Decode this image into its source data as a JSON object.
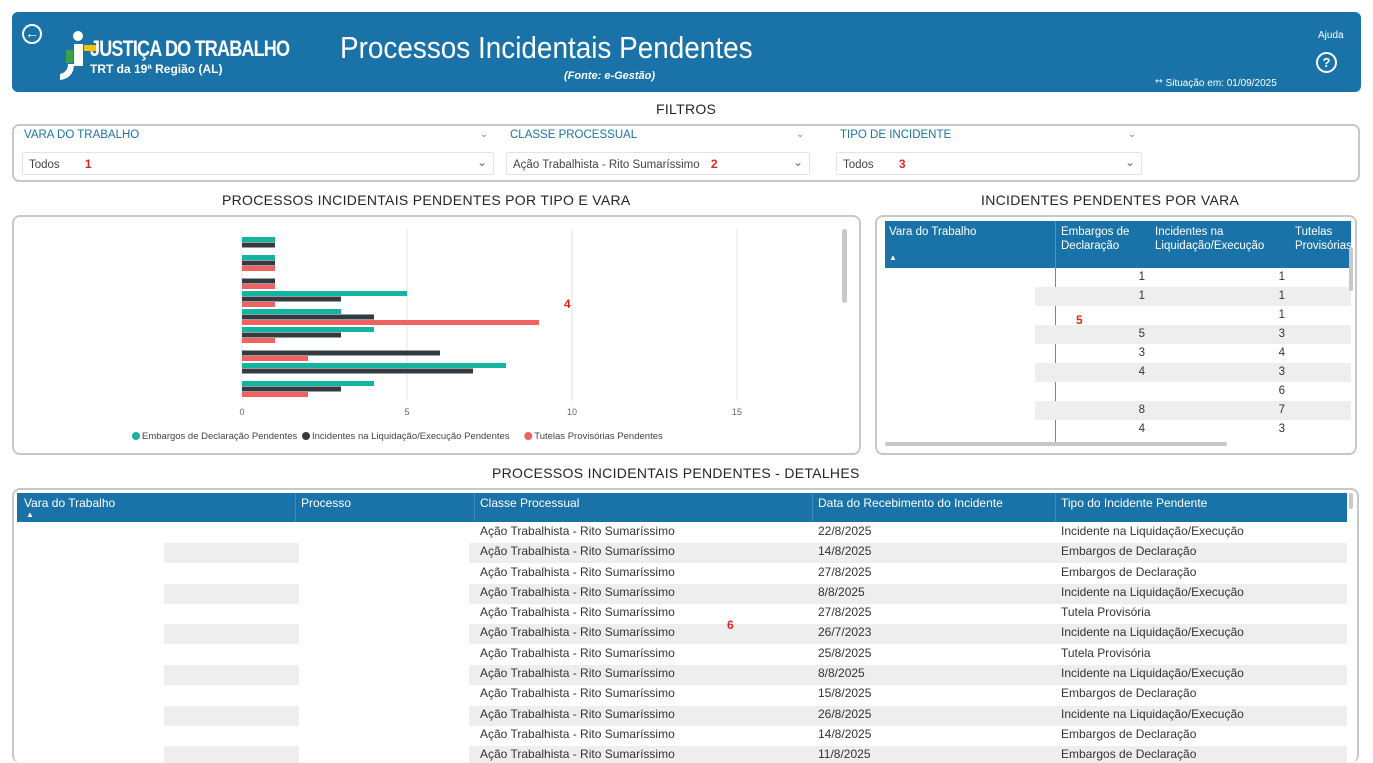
{
  "header": {
    "back_icon": "back-arrow-icon",
    "logo_title": "JUSTIÇA DO TRABALHO",
    "logo_subtitle": "TRT da 19ª Região (AL)",
    "title": "Processos Incidentais Pendentes",
    "source": "(Fonte: e-Gestão)",
    "situacao": "** Situação em: 01/09/2025",
    "help_label": "Ajuda",
    "help_icon": "help-circle-icon"
  },
  "colors": {
    "brand": "#1a73a8",
    "teal": "#13b5a0",
    "dark": "#333b40",
    "salmon": "#f0625f",
    "marker": "#e0271f"
  },
  "filters": {
    "title": "FILTROS",
    "items": [
      {
        "label": "VARA DO TRABALHO",
        "value": "Todos",
        "marker": "1"
      },
      {
        "label": "CLASSE PROCESSUAL",
        "value": "Ação Trabalhista - Rito Sumaríssimo",
        "marker": "2"
      },
      {
        "label": "TIPO DE INCIDENTE",
        "value": "Todos",
        "marker": "3"
      }
    ]
  },
  "chart_section_title": "PROCESSOS INCIDENTAIS PENDENTES POR TIPO E VARA",
  "chart_marker": "4",
  "chart_data": {
    "type": "bar",
    "orientation": "horizontal",
    "xlim": [
      0,
      15
    ],
    "xticks": [
      0,
      5,
      10,
      15
    ],
    "grid": true,
    "legend_position": "bottom",
    "series": [
      {
        "name": "Embargos de Declaração Pendentes",
        "color": "#13b5a0",
        "values": [
          1,
          1,
          0,
          5,
          3,
          4,
          0,
          8,
          4
        ]
      },
      {
        "name": "Incidentes na Liquidação/Execução Pendentes",
        "color": "#333b40",
        "values": [
          1,
          1,
          1,
          3,
          4,
          3,
          6,
          7,
          3
        ]
      },
      {
        "name": "Tutelas Provisórias Pendentes",
        "color": "#f0625f",
        "values": [
          0,
          1,
          1,
          1,
          9,
          1,
          2,
          0,
          2
        ]
      }
    ]
  },
  "pivot": {
    "title": "INCIDENTES PENDENTES POR VARA",
    "marker": "5",
    "sort_icon": "sort-ascending-icon",
    "headers": [
      "Vara do Trabalho",
      "Embargos de Declaração",
      "Incidentes na Liquidação/Execução",
      "Tutelas Provisórias"
    ],
    "rows": [
      [
        "1",
        "1"
      ],
      [
        "1",
        "1"
      ],
      [
        "",
        "1"
      ],
      [
        "5",
        "3"
      ],
      [
        "3",
        "4"
      ],
      [
        "4",
        "3"
      ],
      [
        "",
        "6"
      ],
      [
        "8",
        "7"
      ],
      [
        "4",
        "3"
      ]
    ]
  },
  "details": {
    "title": "PROCESSOS INCIDENTAIS PENDENTES - DETALHES",
    "marker": "6",
    "sort_icon": "sort-ascending-icon",
    "headers": [
      "Vara do Trabalho",
      "Processo",
      "Classe Processual",
      "Data do Recebimento do Incidente",
      "Tipo do Incidente Pendente"
    ],
    "rows": [
      [
        "Ação Trabalhista - Rito Sumaríssimo",
        "22/8/2025",
        "Incidente na Liquidação/Execução"
      ],
      [
        "Ação Trabalhista - Rito Sumaríssimo",
        "14/8/2025",
        "Embargos de Declaração"
      ],
      [
        "Ação Trabalhista - Rito Sumaríssimo",
        "27/8/2025",
        "Embargos de Declaração"
      ],
      [
        "Ação Trabalhista - Rito Sumaríssimo",
        "8/8/2025",
        "Incidente na Liquidação/Execução"
      ],
      [
        "Ação Trabalhista - Rito Sumaríssimo",
        "27/8/2025",
        "Tutela Provisória"
      ],
      [
        "Ação Trabalhista - Rito Sumaríssimo",
        "26/7/2023",
        "Incidente na Liquidação/Execução"
      ],
      [
        "Ação Trabalhista - Rito Sumaríssimo",
        "25/8/2025",
        "Tutela Provisória"
      ],
      [
        "Ação Trabalhista - Rito Sumaríssimo",
        "8/8/2025",
        "Incidente na Liquidação/Execução"
      ],
      [
        "Ação Trabalhista - Rito Sumaríssimo",
        "15/8/2025",
        "Embargos de Declaração"
      ],
      [
        "Ação Trabalhista - Rito Sumaríssimo",
        "26/8/2025",
        "Incidente na Liquidação/Execução"
      ],
      [
        "Ação Trabalhista - Rito Sumaríssimo",
        "14/8/2025",
        "Embargos de Declaração"
      ],
      [
        "Ação Trabalhista - Rito Sumaríssimo",
        "11/8/2025",
        "Embargos de Declaração"
      ]
    ]
  }
}
